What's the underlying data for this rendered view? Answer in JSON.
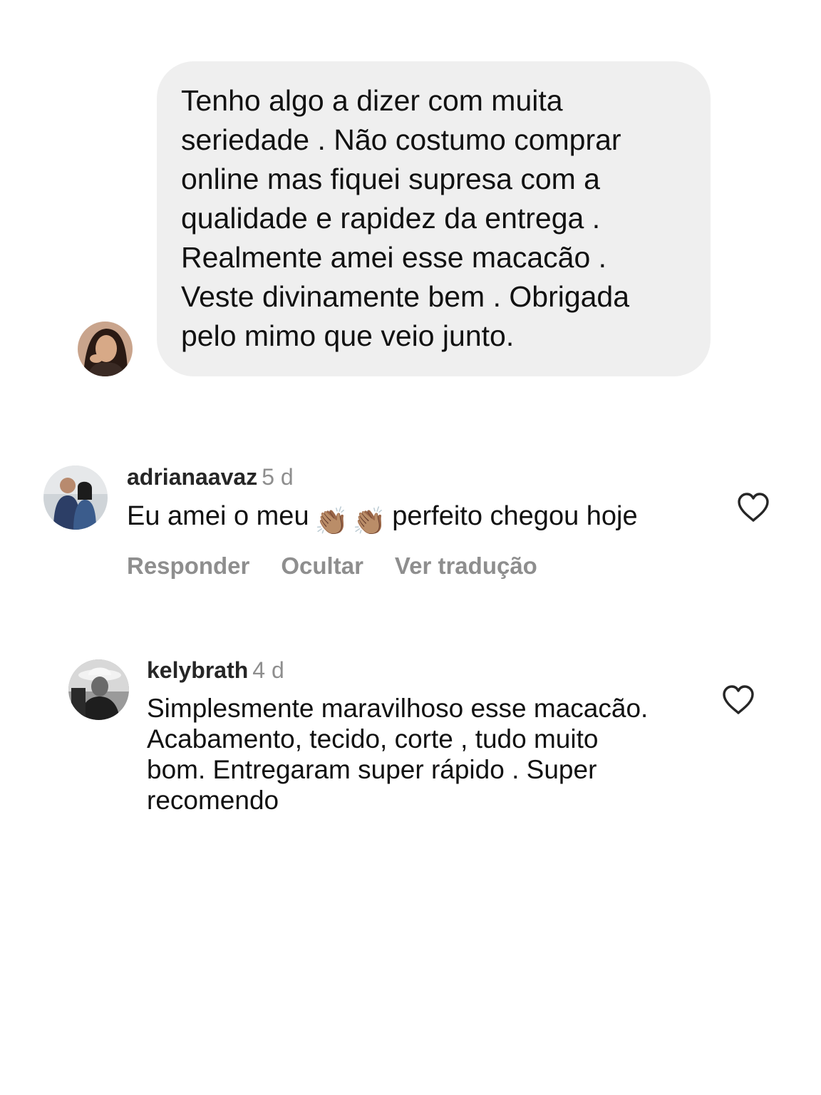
{
  "message": {
    "text": "Tenho algo a dizer com muita\nseriedade . Não costumo comprar\nonline mas fiquei supresa com a\nqualidade e rapidez da entrega  .\nRealmente amei esse macacão .\nVeste divinamente bem .  Obrigada\npelo mimo que veio junto.",
    "bubble_color": "#efefef"
  },
  "comments": [
    {
      "username": "adrianaavaz",
      "time": "5 d",
      "text_before": "Eu amei o meu",
      "emoji": "👏🏽",
      "text_after": "perfeito chegou hoje",
      "actions": {
        "reply": "Responder",
        "hide": "Ocultar",
        "translate": "Ver tradução"
      },
      "like_icon": "heart-outline-icon"
    },
    {
      "username": "kelybrath",
      "time": "4 d",
      "text": "Simplesmente maravilhoso esse macacão.\nAcabamento, tecido, corte , tudo muito\nbom. Entregaram super rápido . Super\nrecomendo",
      "like_icon": "heart-outline-icon"
    }
  ],
  "colors": {
    "secondary_text": "#8e8e8e",
    "username": "#262626"
  }
}
